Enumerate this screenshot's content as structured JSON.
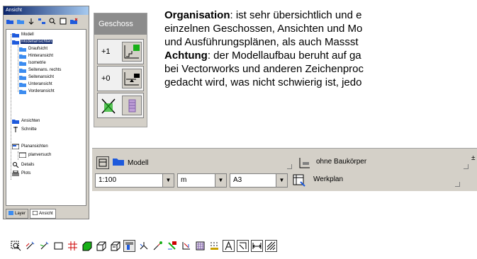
{
  "navigator": {
    "title": "Ansicht",
    "tree": [
      {
        "label": "Modell"
      },
      {
        "label": "Modellansichten"
      },
      {
        "label": "Draufsicht"
      },
      {
        "label": "Hinteransicht"
      },
      {
        "label": "Isometrie"
      },
      {
        "label": "Seitenans. rechts"
      },
      {
        "label": "Seitenansicht"
      },
      {
        "label": "Unteransicht"
      },
      {
        "label": "Vorderansicht"
      },
      {
        "label": "Ansichten"
      },
      {
        "label": "Schnitte"
      },
      {
        "label": "Planansichten"
      },
      {
        "label": "planversuch"
      },
      {
        "label": "Details"
      },
      {
        "label": "Plots"
      }
    ],
    "tabs": [
      {
        "label": "Layer"
      },
      {
        "label": "Ansicht"
      }
    ]
  },
  "geschoss": {
    "title": "Geschoss",
    "levels": [
      {
        "label": "+1"
      },
      {
        "label": "+0"
      }
    ]
  },
  "paragraph": {
    "line1_bold": "Organisation",
    "line1_rest": ": ist sehr übersichtlich und e",
    "line2": "einzelnen Geschossen, Ansichten und Mo",
    "line3": "und Ausführungsplänen, als auch Massst",
    "line4_bold": "Achtung",
    "line4_rest": ": der Modellaufbau beruht auf ga",
    "line5": "bei Vectorworks und anderen Zeichenproc",
    "line6": "gedacht wird, was nicht schwierig ist, jedo"
  },
  "infobar": {
    "view_name": "Modell",
    "layer_filter": "ohne Baukörper",
    "scale": "1:100",
    "unit": "m",
    "paper": "A3",
    "plan_type": "Werkplan",
    "right_edge": "±"
  },
  "toolbar": {
    "tools": [
      "zoom-select-icon",
      "rotate-view-icon",
      "orbit-view-icon",
      "rectangle-icon",
      "grid-snap-icon",
      "solid-box-icon",
      "wire-box-icon",
      "hidden-box-icon",
      "active-tool-icon",
      "axis-move-icon",
      "axis-rotate-icon",
      "light-icon",
      "slope-icon",
      "hatch-icon",
      "dots-grid-icon",
      "text-tool-icon",
      "dimension-tool-icon",
      "measure-tool-icon",
      "fill-tool-icon"
    ],
    "pressed_index": 8,
    "boxed_indices": [
      15,
      16,
      17,
      18
    ]
  },
  "colors": {
    "panel": "#d4d0c8",
    "selection": "#0a246a",
    "geschoss_title": "#8c8c8c",
    "folder_blue": "#1e5adc"
  }
}
